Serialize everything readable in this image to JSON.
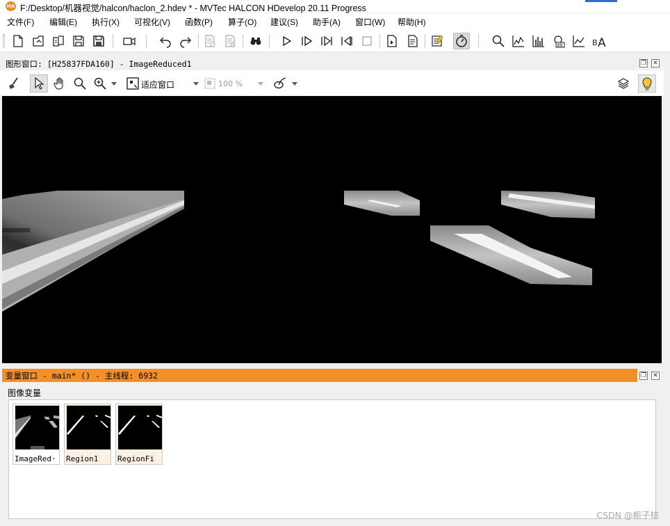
{
  "title": "F:/Desktop/机器视觉/halcon/haclon_2.hdev * - MVTec HALCON HDevelop 20.11 Progress",
  "app_icon_text": "HA",
  "menu": [
    {
      "label": "文件(F)"
    },
    {
      "label": "编辑(E)"
    },
    {
      "label": "执行(X)"
    },
    {
      "label": "可视化(V)"
    },
    {
      "label": "函数(P)"
    },
    {
      "label": "算子(O)"
    },
    {
      "label": "建议(S)"
    },
    {
      "label": "助手(A)"
    },
    {
      "label": "窗口(W)"
    },
    {
      "label": "帮助(H)"
    }
  ],
  "graphics_window": {
    "title": "图形窗口: [H25837FDA160] - ImageReduced1",
    "fit_label": "适应窗口",
    "zoom_value": "100 %"
  },
  "variables_window": {
    "title": "变量窗口 - main* () - 主线程: 6932",
    "section_label": "图像变量",
    "items": [
      {
        "label": "ImageRed·"
      },
      {
        "label": "Region1"
      },
      {
        "label": "RegionFi"
      }
    ]
  },
  "watermark": "CSDN @栀子桔",
  "colors": {
    "accent_orange": "#f29027",
    "app_icon": "#e98a2c"
  }
}
